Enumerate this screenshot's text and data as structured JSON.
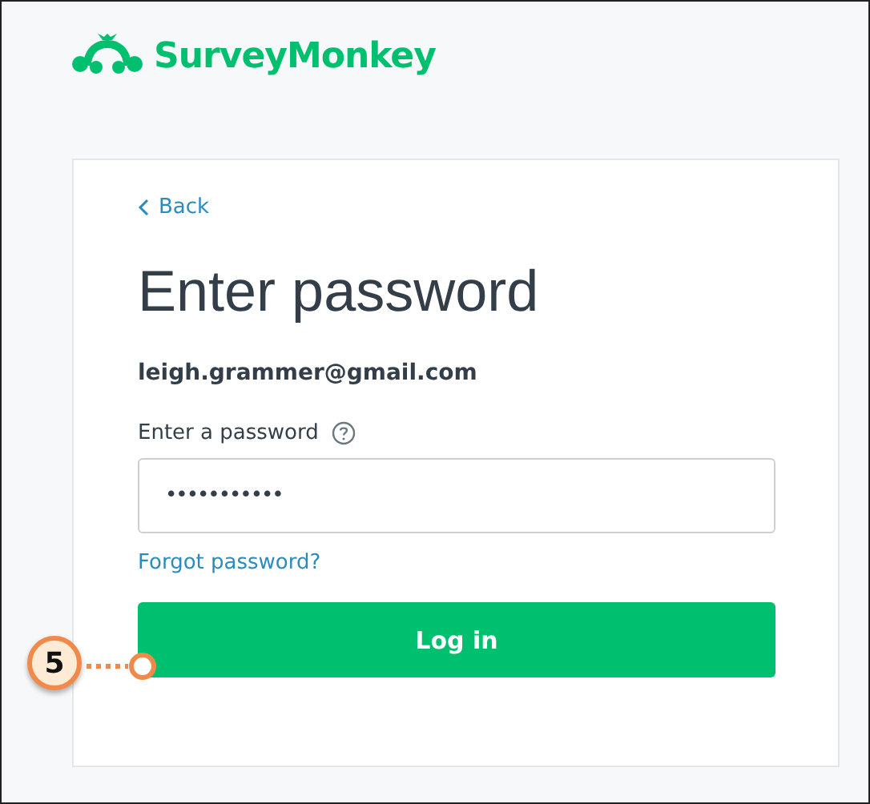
{
  "header": {
    "logo_text": "SurveyMonkey"
  },
  "card": {
    "back_link": "Back",
    "title": "Enter password",
    "email": "leigh.grammer@gmail.com",
    "password_label": "Enter a password",
    "password_value": "•••••••••••",
    "forgot_link": "Forgot password?",
    "login_button": "Log in"
  },
  "callout": {
    "number": "5"
  }
}
